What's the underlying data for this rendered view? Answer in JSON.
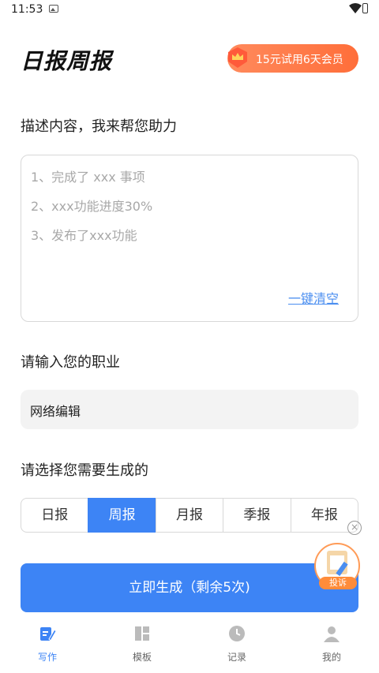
{
  "status_bar": {
    "time": "11:53"
  },
  "header": {
    "title": "日报周报",
    "vip_badge": "15元试用6天会员"
  },
  "form": {
    "describe_label": "描述内容，我来帮您助力",
    "placeholder_lines": [
      "1、完成了 xxx 事项",
      "2、xxx功能进度30%",
      "3、发布了xxx功能"
    ],
    "clear_link": "一键清空",
    "occupation_label": "请输入您的职业",
    "occupation_value": "网络编辑",
    "report_type_label": "请选择您需要生成的",
    "report_types": [
      "日报",
      "周报",
      "月报",
      "季报",
      "年报"
    ],
    "selected_report_type": "周报",
    "generate_button": "立即生成（剩余5次)"
  },
  "floating": {
    "complaint_label": "投诉"
  },
  "tabbar": {
    "items": [
      {
        "label": "写作",
        "icon": "edit-icon",
        "active": true
      },
      {
        "label": "模板",
        "icon": "template-icon",
        "active": false
      },
      {
        "label": "记录",
        "icon": "clock-icon",
        "active": false
      },
      {
        "label": "我的",
        "icon": "user-icon",
        "active": false
      }
    ]
  },
  "colors": {
    "accent": "#3d84f5",
    "vip": "#ff7a45"
  }
}
